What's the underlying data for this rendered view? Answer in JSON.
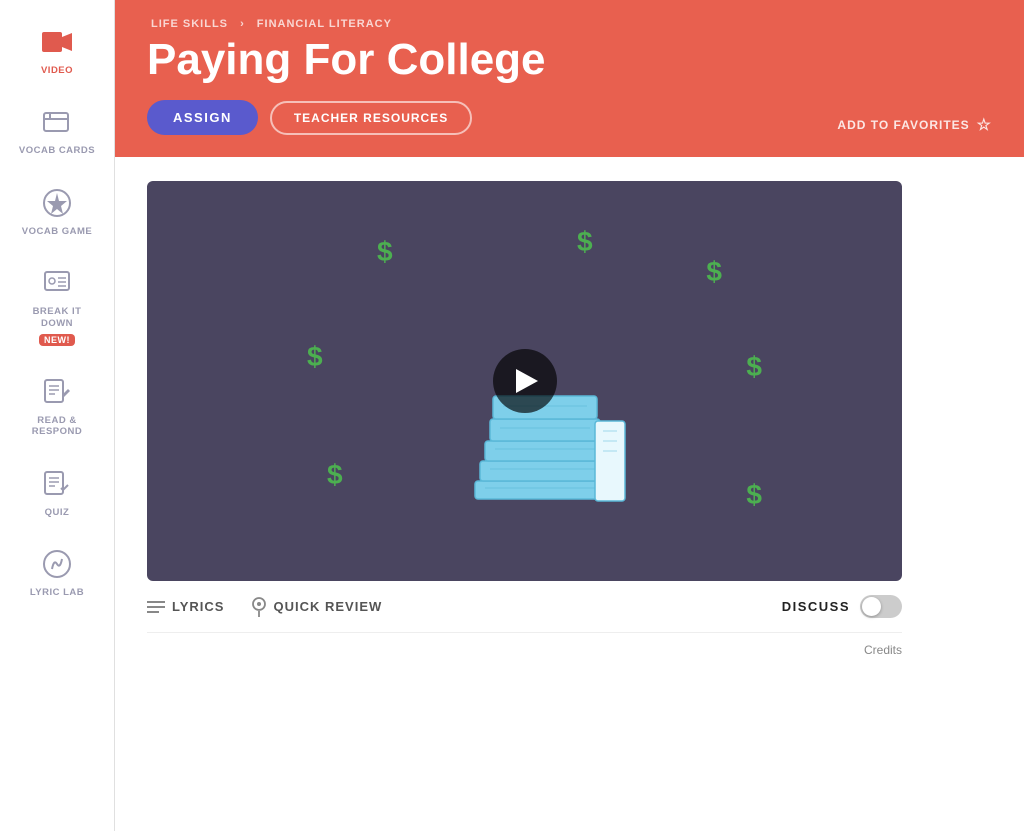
{
  "breadcrumb": {
    "part1": "LIFE SKILLS",
    "separator": "›",
    "part2": "FINANCIAL LITERACY"
  },
  "hero": {
    "title": "Paying For College",
    "assign_label": "ASSIGN",
    "teacher_resources_label": "TEACHER RESOURCES",
    "add_to_favorites_label": "ADD TO FAVORITES"
  },
  "sidebar": {
    "items": [
      {
        "id": "video",
        "label": "VIDEO",
        "active": true
      },
      {
        "id": "vocab-cards",
        "label": "VOCAB CARDS",
        "active": false
      },
      {
        "id": "vocab-game",
        "label": "VOCAB GAME",
        "active": false
      },
      {
        "id": "break-it-down",
        "label": "BREAK IT\nDOWN",
        "active": false,
        "badge": "NEW!"
      },
      {
        "id": "read-respond",
        "label": "READ &\nRESPOND",
        "active": false
      },
      {
        "id": "quiz",
        "label": "QUIZ",
        "active": false
      },
      {
        "id": "lyric-lab",
        "label": "LYRIC LAB",
        "active": false
      }
    ]
  },
  "video_controls": {
    "lyrics_label": "LYRICS",
    "quick_review_label": "QUICK REVIEW",
    "discuss_label": "DISCUSS"
  },
  "credits_label": "Credits",
  "dollar_signs": [
    "$",
    "$",
    "$",
    "$",
    "$",
    "$",
    "$"
  ]
}
